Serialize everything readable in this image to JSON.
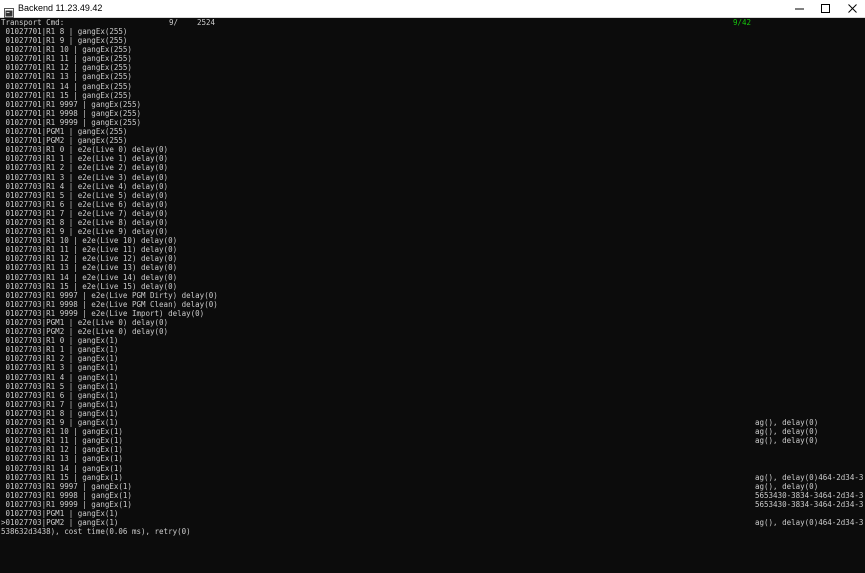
{
  "window": {
    "title": "Backend 11.23.49.42"
  },
  "header": {
    "label": "Transport Cmd:",
    "count": "9/",
    "total": "2524",
    "status": "9/42"
  },
  "lines": [
    {
      "text": " 01027701|R1 8 | gangEx(255)",
      "right": ""
    },
    {
      "text": " 01027701|R1 9 | gangEx(255)",
      "right": ""
    },
    {
      "text": " 01027701|R1 10 | gangEx(255)",
      "right": ""
    },
    {
      "text": " 01027701|R1 11 | gangEx(255)",
      "right": ""
    },
    {
      "text": " 01027701|R1 12 | gangEx(255)",
      "right": ""
    },
    {
      "text": " 01027701|R1 13 | gangEx(255)",
      "right": ""
    },
    {
      "text": " 01027701|R1 14 | gangEx(255)",
      "right": ""
    },
    {
      "text": " 01027701|R1 15 | gangEx(255)",
      "right": ""
    },
    {
      "text": " 01027701|R1 9997 | gangEx(255)",
      "right": ""
    },
    {
      "text": " 01027701|R1 9998 | gangEx(255)",
      "right": ""
    },
    {
      "text": " 01027701|R1 9999 | gangEx(255)",
      "right": ""
    },
    {
      "text": " 01027701|PGM1 | gangEx(255)",
      "right": ""
    },
    {
      "text": " 01027701|PGM2 | gangEx(255)",
      "right": ""
    },
    {
      "text": " 01027703|R1 0 | e2e(Live 0) delay(0)",
      "right": ""
    },
    {
      "text": " 01027703|R1 1 | e2e(Live 1) delay(0)",
      "right": ""
    },
    {
      "text": " 01027703|R1 2 | e2e(Live 2) delay(0)",
      "right": ""
    },
    {
      "text": " 01027703|R1 3 | e2e(Live 3) delay(0)",
      "right": ""
    },
    {
      "text": " 01027703|R1 4 | e2e(Live 4) delay(0)",
      "right": ""
    },
    {
      "text": " 01027703|R1 5 | e2e(Live 5) delay(0)",
      "right": ""
    },
    {
      "text": " 01027703|R1 6 | e2e(Live 6) delay(0)",
      "right": ""
    },
    {
      "text": " 01027703|R1 7 | e2e(Live 7) delay(0)",
      "right": ""
    },
    {
      "text": " 01027703|R1 8 | e2e(Live 8) delay(0)",
      "right": ""
    },
    {
      "text": " 01027703|R1 9 | e2e(Live 9) delay(0)",
      "right": ""
    },
    {
      "text": " 01027703|R1 10 | e2e(Live 10) delay(0)",
      "right": ""
    },
    {
      "text": " 01027703|R1 11 | e2e(Live 11) delay(0)",
      "right": ""
    },
    {
      "text": " 01027703|R1 12 | e2e(Live 12) delay(0)",
      "right": ""
    },
    {
      "text": " 01027703|R1 13 | e2e(Live 13) delay(0)",
      "right": ""
    },
    {
      "text": " 01027703|R1 14 | e2e(Live 14) delay(0)",
      "right": ""
    },
    {
      "text": " 01027703|R1 15 | e2e(Live 15) delay(0)",
      "right": ""
    },
    {
      "text": " 01027703|R1 9997 | e2e(Live PGM Dirty) delay(0)",
      "right": ""
    },
    {
      "text": " 01027703|R1 9998 | e2e(Live PGM Clean) delay(0)",
      "right": ""
    },
    {
      "text": " 01027703|R1 9999 | e2e(Live Import) delay(0)",
      "right": ""
    },
    {
      "text": " 01027703|PGM1 | e2e(Live 0) delay(0)",
      "right": ""
    },
    {
      "text": " 01027703|PGM2 | e2e(Live 0) delay(0)",
      "right": ""
    },
    {
      "text": " 01027703|R1 0 | gangEx(1)",
      "right": ""
    },
    {
      "text": " 01027703|R1 1 | gangEx(1)",
      "right": ""
    },
    {
      "text": " 01027703|R1 2 | gangEx(1)",
      "right": ""
    },
    {
      "text": " 01027703|R1 3 | gangEx(1)",
      "right": ""
    },
    {
      "text": " 01027703|R1 4 | gangEx(1)",
      "right": ""
    },
    {
      "text": " 01027703|R1 5 | gangEx(1)",
      "right": ""
    },
    {
      "text": " 01027703|R1 6 | gangEx(1)",
      "right": ""
    },
    {
      "text": " 01027703|R1 7 | gangEx(1)",
      "right": ""
    },
    {
      "text": " 01027703|R1 8 | gangEx(1)",
      "right": ""
    },
    {
      "text": " 01027703|R1 9 | gangEx(1)",
      "right": "ag(), delay(0)"
    },
    {
      "text": " 01027703|R1 10 | gangEx(1)",
      "right": "ag(), delay(0)"
    },
    {
      "text": " 01027703|R1 11 | gangEx(1)",
      "right": "ag(), delay(0)"
    },
    {
      "text": " 01027703|R1 12 | gangEx(1)",
      "right": ""
    },
    {
      "text": " 01027703|R1 13 | gangEx(1)",
      "right": ""
    },
    {
      "text": " 01027703|R1 14 | gangEx(1)",
      "right": ""
    },
    {
      "text": " 01027703|R1 15 | gangEx(1)",
      "right": "ag(), delay(0)464-2d34-3"
    },
    {
      "text": " 01027703|R1 9997 | gangEx(1)",
      "right": "ag(), delay(0)"
    },
    {
      "text": " 01027703|R1 9998 | gangEx(1)",
      "right": "5653430-3834-3464-2d34-3"
    },
    {
      "text": " 01027703|R1 9999 | gangEx(1)",
      "right": "5653430-3834-3464-2d34-3"
    },
    {
      "text": " 01027703|PGM1 | gangEx(1)",
      "right": ""
    },
    {
      "text": ">01027703|PGM2 | gangEx(1)",
      "right": "ag(), delay(0)464-2d34-3"
    },
    {
      "text": "538632d3438), cost time(0.06 ms), retry(0)",
      "right": ""
    }
  ]
}
